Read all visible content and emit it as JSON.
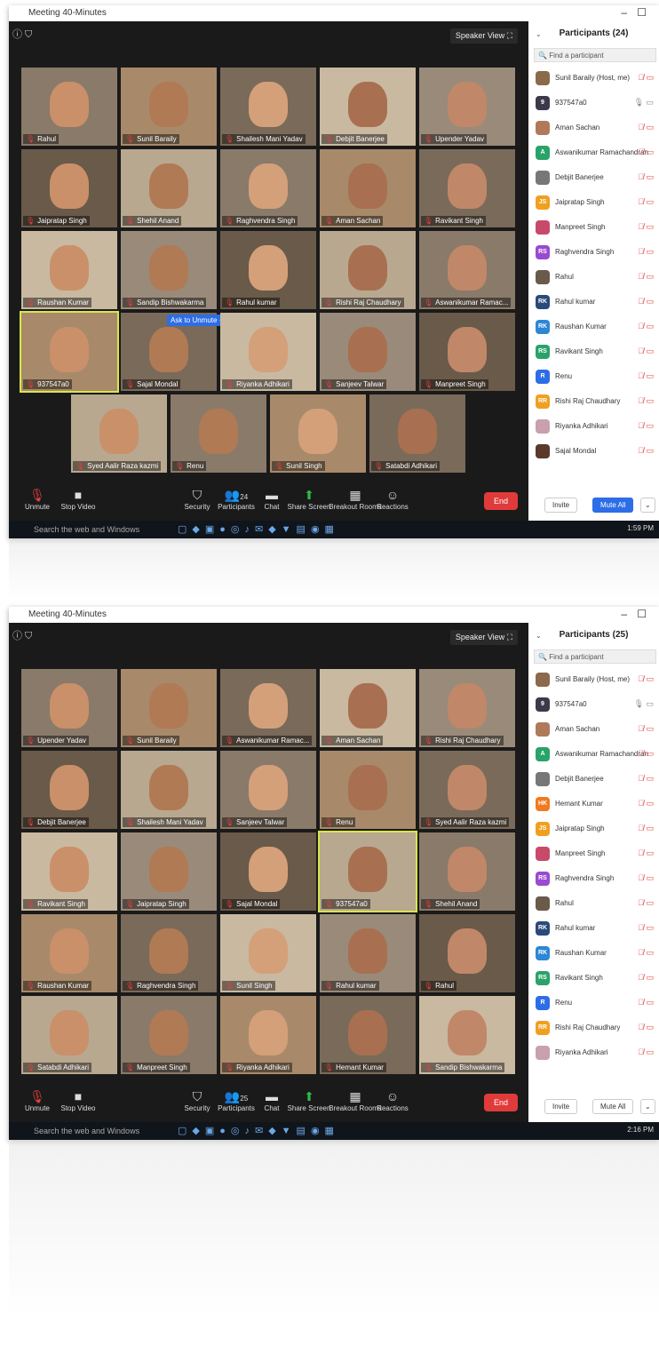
{
  "top": {
    "title": "Meeting 40-Minutes",
    "speaker_view": "Speaker View",
    "participants_header": "Participants (24)",
    "find_placeholder": "Find a participant",
    "ask_to_unmute": "Ask to Unmute",
    "tiles": [
      "Rahul",
      "Sunil Baraily",
      "Shailesh Mani Yadav",
      "Debjit Banerjee",
      "Upender Yadav",
      "Jaipratap Singh",
      "Shehil Anand",
      "Raghvendra Singh",
      "Aman Sachan",
      "Ravikant Singh",
      "Raushan Kumar",
      "Sandip Bishwakarma",
      "Rahul kumar",
      "Rishi Raj Chaudhary",
      "Aswanikumar Ramac...",
      "937547a0",
      "Sajal Mondal",
      "Riyanka Adhikari",
      "Sanjeev Talwar",
      "Manpreet Singh",
      "Syed Aalir Raza kazmi",
      "Renu",
      "Sunil Singh",
      "Satabdi Adhikari"
    ],
    "participants": [
      {
        "initials": "",
        "name": "Sunil Baraily (Host, me)",
        "color": "#8a6a4a"
      },
      {
        "initials": "9",
        "name": "937547a0",
        "color": "#3a3a4a",
        "mic_on": true
      },
      {
        "initials": "",
        "name": "Aman Sachan",
        "color": "#b07a5a"
      },
      {
        "initials": "A",
        "name": "Aswanikumar Ramachandran",
        "color": "#2aa36a"
      },
      {
        "initials": "",
        "name": "Debjit Banerjee",
        "color": "#777777"
      },
      {
        "initials": "JS",
        "name": "Jaipratap Singh",
        "color": "#f0a020"
      },
      {
        "initials": "",
        "name": "Manpreet Singh",
        "color": "#c84a6a"
      },
      {
        "initials": "RS",
        "name": "Raghvendra Singh",
        "color": "#9a4ad0"
      },
      {
        "initials": "",
        "name": "Rahul",
        "color": "#6a5a4a"
      },
      {
        "initials": "RK",
        "name": "Rahul kumar",
        "color": "#2a4a7a"
      },
      {
        "initials": "RK",
        "name": "Raushan Kumar",
        "color": "#2d86d6"
      },
      {
        "initials": "RS",
        "name": "Ravikant Singh",
        "color": "#2aa36a"
      },
      {
        "initials": "R",
        "name": "Renu",
        "color": "#2d6ee6"
      },
      {
        "initials": "RR",
        "name": "Rishi Raj Chaudhary",
        "color": "#f0a020"
      },
      {
        "initials": "",
        "name": "Riyanka Adhikari",
        "color": "#c8a0b0"
      },
      {
        "initials": "",
        "name": "Sajal Mondal",
        "color": "#5a3a2a"
      }
    ],
    "clock": "1:59 PM"
  },
  "bottom": {
    "title": "Meeting 40-Minutes",
    "speaker_view": "Speaker View",
    "participants_header": "Participants (25)",
    "find_placeholder": "Find a participant",
    "tiles": [
      "Upender Yadav",
      "Sunil Baraily",
      "Aswanikumar Ramac...",
      "Aman Sachan",
      "Rishi Raj Chaudhary",
      "Debjit Banerjee",
      "Shailesh Mani Yadav",
      "Sanjeev Talwar",
      "Renu",
      "Syed Aalir Raza kazmi",
      "Ravikant Singh",
      "Jaipratap Singh",
      "Sajal Mondal",
      "937547a0",
      "Shehil Anand",
      "Raushan Kumar",
      "Raghvendra Singh",
      "Sunil Singh",
      "Rahul kumar",
      "Rahul",
      "Satabdi Adhikari",
      "Manpreet Singh",
      "Riyanka Adhikari",
      "Hemant Kumar",
      "Sandip Bishwakarma"
    ],
    "participants": [
      {
        "initials": "",
        "name": "Sunil Baraily (Host, me)",
        "color": "#8a6a4a"
      },
      {
        "initials": "9",
        "name": "937547a0",
        "color": "#3a3a4a",
        "mic_on": true
      },
      {
        "initials": "",
        "name": "Aman Sachan",
        "color": "#b07a5a"
      },
      {
        "initials": "A",
        "name": "Aswanikumar Ramachandran",
        "color": "#2aa36a"
      },
      {
        "initials": "",
        "name": "Debjit Banerjee",
        "color": "#777777"
      },
      {
        "initials": "HK",
        "name": "Hemant Kumar",
        "color": "#f07a20"
      },
      {
        "initials": "JS",
        "name": "Jaipratap Singh",
        "color": "#f0a020"
      },
      {
        "initials": "",
        "name": "Manpreet Singh",
        "color": "#c84a6a"
      },
      {
        "initials": "RS",
        "name": "Raghvendra Singh",
        "color": "#9a4ad0"
      },
      {
        "initials": "",
        "name": "Rahul",
        "color": "#6a5a4a"
      },
      {
        "initials": "RK",
        "name": "Rahul kumar",
        "color": "#2a4a7a"
      },
      {
        "initials": "RK",
        "name": "Raushan Kumar",
        "color": "#2d86d6"
      },
      {
        "initials": "RS",
        "name": "Ravikant Singh",
        "color": "#2aa36a"
      },
      {
        "initials": "R",
        "name": "Renu",
        "color": "#2d6ee6"
      },
      {
        "initials": "RR",
        "name": "Rishi Raj Chaudhary",
        "color": "#f0a020"
      },
      {
        "initials": "",
        "name": "Riyanka Adhikari",
        "color": "#c8a0b0"
      }
    ],
    "participants_count": "25",
    "clock": "2:16 PM"
  },
  "toolbar": {
    "unmute": "Unmute",
    "stop_video": "Stop Video",
    "security": "Security",
    "participants": "Participants",
    "participants_count_top": "24",
    "chat": "Chat",
    "share_screen": "Share Screen",
    "breakout_rooms": "Breakout Rooms",
    "reactions": "Reactions",
    "end": "End",
    "invite": "Invite",
    "mute_all": "Mute All"
  },
  "taskbar": {
    "search": "Search the web and Windows"
  },
  "colors": {
    "accent": "#2d6ee6",
    "end_red": "#e03a3a",
    "mute_red": "#e34040",
    "active_border": "#d8e64a"
  }
}
